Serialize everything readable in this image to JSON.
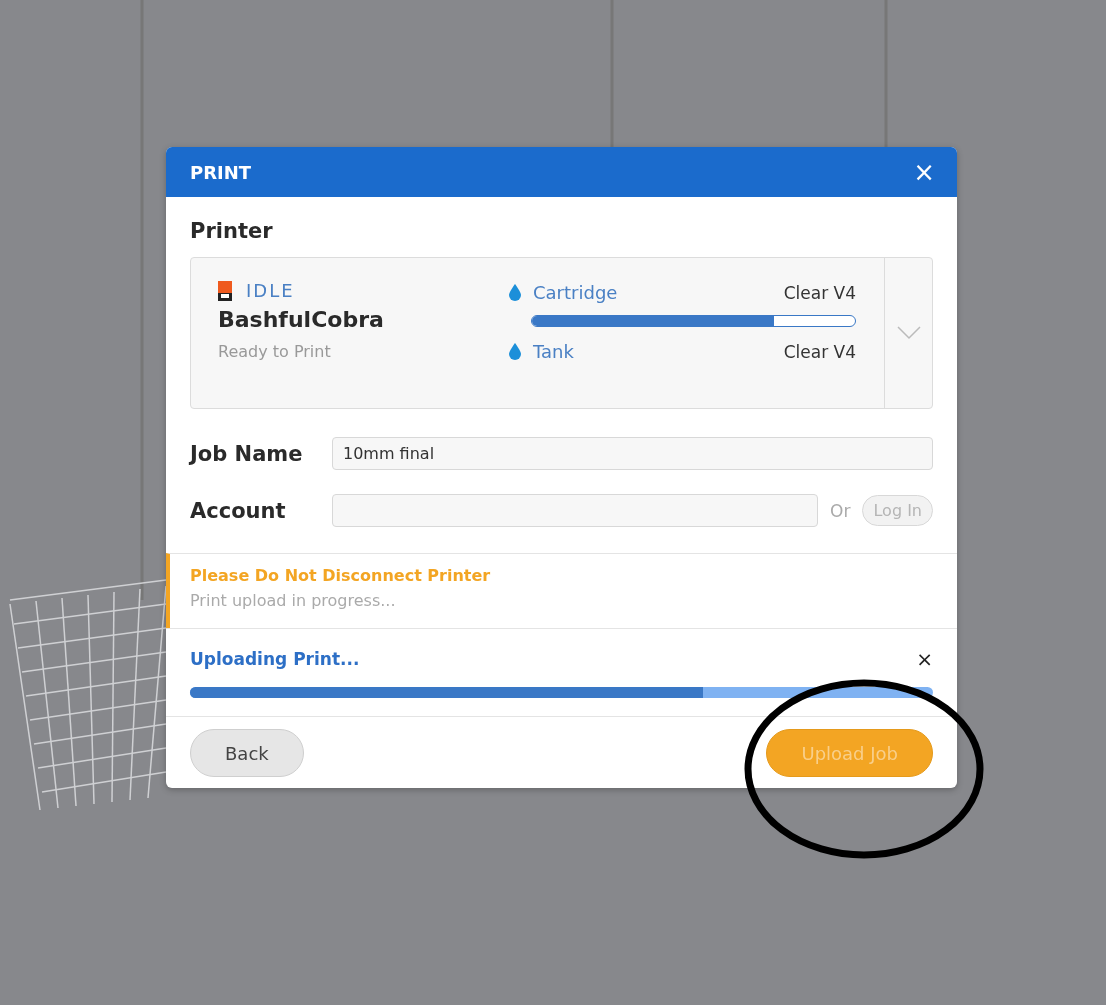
{
  "dialog": {
    "title": "PRINT",
    "close": "×"
  },
  "printer": {
    "heading": "Printer",
    "status": "IDLE",
    "name": "BashfulCobra",
    "state_text": "Ready to Print",
    "materials": [
      {
        "label": "Cartridge",
        "value": "Clear V4",
        "level": 0.75
      },
      {
        "label": "Tank",
        "value": "Clear V4"
      }
    ]
  },
  "job_name": {
    "label": "Job Name",
    "value": "10mm final"
  },
  "account": {
    "label": "Account",
    "or": "Or",
    "login": "Log In",
    "login_disabled": true
  },
  "warning": {
    "title": "Please Do Not Disconnect Printer",
    "message": "Print upload in progress..."
  },
  "upload": {
    "title": "Uploading Print...",
    "close": "×",
    "level": 0.69
  },
  "buttons": [
    {
      "label": "Back",
      "kind": "secondary",
      "disabled": false
    },
    {
      "label": "Upload Job",
      "kind": "primary",
      "disabled": true
    }
  ]
}
